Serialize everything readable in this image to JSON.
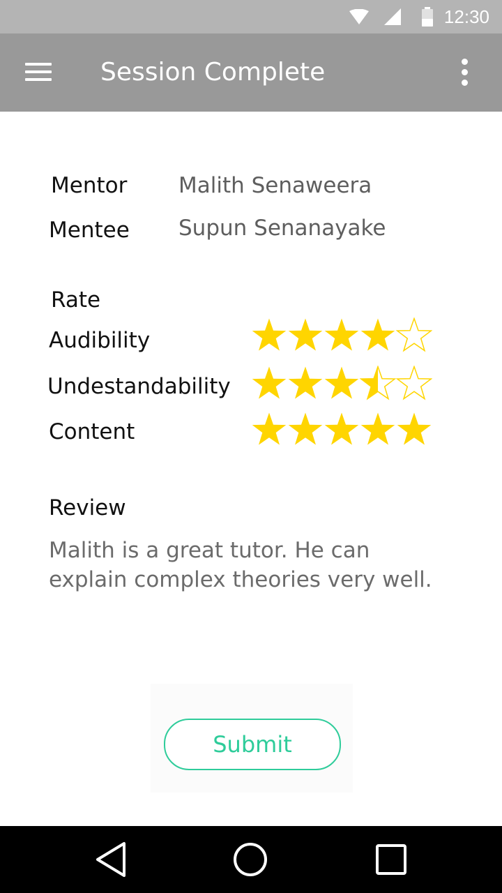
{
  "status_bar": {
    "time": "12:30",
    "icons": [
      "wifi-icon",
      "cell-signal-icon",
      "battery-icon"
    ]
  },
  "app_bar": {
    "title": "Session Complete",
    "menu_icon": "menu-icon",
    "overflow_icon": "more-vert-icon"
  },
  "session": {
    "mentor_label": "Mentor",
    "mentor_name": "Malith Senaweera",
    "mentee_label": "Mentee",
    "mentee_name": "Supun Senanayake"
  },
  "rating": {
    "heading": "Rate",
    "max": 5,
    "items": [
      {
        "label": "Audibility",
        "value": 4
      },
      {
        "label": "Undestandability",
        "value": 3.5
      },
      {
        "label": "Content",
        "value": 5
      }
    ]
  },
  "review": {
    "heading": "Review",
    "text": "Malith is a great tutor. He can explain complex theories very well."
  },
  "submit": {
    "label": "Submit"
  },
  "colors": {
    "status_bar": "#b4b4b4",
    "app_bar": "#999999",
    "star_fill": "#ffd500",
    "accent": "#2ecc9a",
    "nav_bar": "#000000"
  },
  "nav_bar": {
    "icons": [
      "back-icon",
      "home-icon",
      "recents-icon"
    ]
  }
}
